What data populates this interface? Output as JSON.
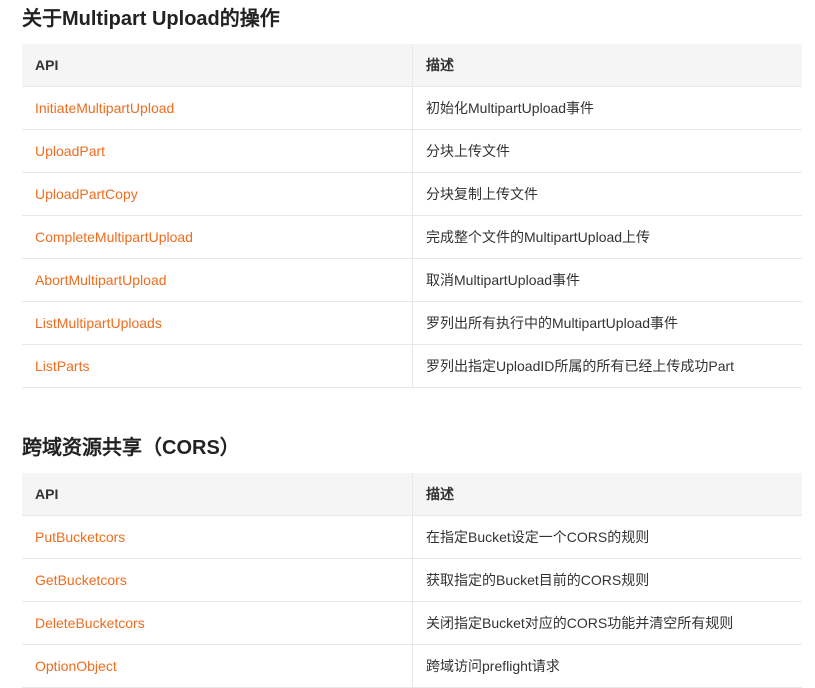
{
  "colors": {
    "link": "#f06c1e",
    "header_bg": "#f5f5f5",
    "border": "#e8e8e8",
    "text": "#333333"
  },
  "multipart": {
    "title": "关于Multipart Upload的操作",
    "headers": {
      "api": "API",
      "desc": "描述"
    },
    "rows": [
      {
        "api": "InitiateMultipartUpload",
        "desc": "初始化MultipartUpload事件"
      },
      {
        "api": "UploadPart",
        "desc": "分块上传文件"
      },
      {
        "api": "UploadPartCopy",
        "desc": "分块复制上传文件"
      },
      {
        "api": "CompleteMultipartUpload",
        "desc": "完成整个文件的MultipartUpload上传"
      },
      {
        "api": "AbortMultipartUpload",
        "desc": "取消MultipartUpload事件"
      },
      {
        "api": "ListMultipartUploads",
        "desc": "罗列出所有执行中的MultipartUpload事件"
      },
      {
        "api": "ListParts",
        "desc": "罗列出指定UploadID所属的所有已经上传成功Part"
      }
    ]
  },
  "cors": {
    "title": "跨域资源共享（CORS）",
    "headers": {
      "api": "API",
      "desc": "描述"
    },
    "rows": [
      {
        "api": "PutBucketcors",
        "desc": "在指定Bucket设定一个CORS的规则"
      },
      {
        "api": "GetBucketcors",
        "desc": "获取指定的Bucket目前的CORS规则"
      },
      {
        "api": "DeleteBucketcors",
        "desc": "关闭指定Bucket对应的CORS功能并清空所有规则"
      },
      {
        "api": "OptionObject",
        "desc": "跨域访问preflight请求"
      }
    ]
  }
}
